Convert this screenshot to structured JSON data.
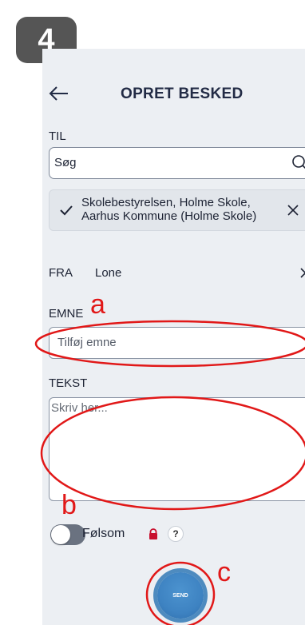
{
  "step_badge": "4",
  "header": {
    "title": "OPRET BESKED"
  },
  "to": {
    "label": "TIL",
    "search_placeholder": "Søg",
    "recipient": "Skolebestyrelsen, Holme Skole, Aarhus Kommune (Holme Skole)"
  },
  "from": {
    "label": "FRA",
    "value": "Lone"
  },
  "subject": {
    "label": "EMNE",
    "placeholder": "Tilføj emne"
  },
  "body_text": {
    "label": "TEKST",
    "placeholder": "Skriv her..."
  },
  "sensitive": {
    "label": "Følsom",
    "help": "?",
    "on": false
  },
  "send_label": "SEND",
  "annotations": {
    "a": "a",
    "b": "b",
    "c": "c",
    "color": "#e11818"
  },
  "icons": [
    "back-arrow-icon",
    "search-icon",
    "check-icon",
    "close-icon",
    "lock-icon",
    "help-icon"
  ]
}
